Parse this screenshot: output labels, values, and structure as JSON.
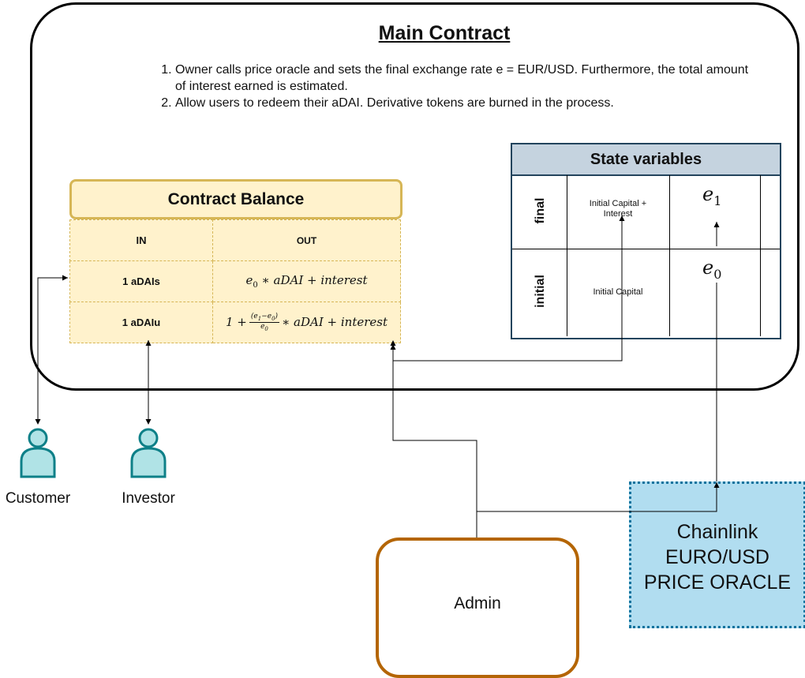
{
  "main_contract": {
    "title": "Main Contract",
    "steps": [
      "Owner calls price oracle and sets the final exchange rate e = EUR/USD. Furthermore, the total amount of interest earned is estimated.",
      "Allow users to redeem their aDAI. Derivative tokens are burned in the process."
    ]
  },
  "contract_balance": {
    "title": "Contract Balance",
    "col_in": "IN",
    "col_out": "OUT",
    "rows": [
      {
        "in": "1 aDAIs"
      },
      {
        "in": "1 aDAIu"
      }
    ]
  },
  "state_variables": {
    "title": "State variables",
    "rows": [
      {
        "label": "final",
        "desc": "Initial Capital + Interest",
        "var_base": "e",
        "var_sub": "1"
      },
      {
        "label": "initial",
        "desc": "Initial Capital",
        "var_base": "e",
        "var_sub": "0"
      }
    ]
  },
  "actors": {
    "customer": "Customer",
    "investor": "Investor",
    "admin": "Admin",
    "oracle_lines": [
      "Chainlink",
      "EURO/USD",
      "PRICE ORACLE"
    ]
  },
  "colors": {
    "balance_fill": "#fff2cc",
    "balance_stroke": "#d6b656",
    "state_header": "#c5d3df",
    "actor_fill": "#b0e3e6",
    "actor_stroke": "#0e8088",
    "admin_stroke": "#b46504",
    "oracle_fill": "#b1ddf0",
    "oracle_stroke": "#10739e"
  },
  "icons": [
    "user-icon"
  ]
}
